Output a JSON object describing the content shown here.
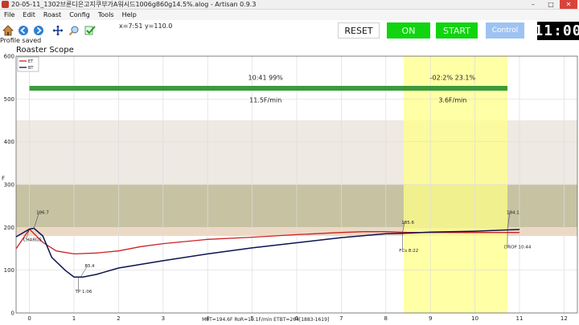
{
  "window": {
    "title": "20-05-11_1302브룬디은고지쿠부가A워시드1006g860g14.5%.alog - Artisan 0.9.3",
    "controls": [
      "–",
      "□",
      "✕"
    ]
  },
  "menu": {
    "items": [
      "File",
      "Edit",
      "Roast",
      "Config",
      "Tools",
      "Help"
    ]
  },
  "toolbar": {
    "icons": [
      "home-icon",
      "back-icon",
      "forward-icon",
      "pan-icon",
      "zoom-icon",
      "check-icon"
    ],
    "coordinates": "x=7:51  y=110.0",
    "status": "Profile saved"
  },
  "buttons": {
    "reset": "RESET",
    "on": "ON",
    "start": "START",
    "control": "Control"
  },
  "lcd": "11:00",
  "colors": {
    "et": "#cc2222",
    "bt": "#0a1450",
    "on_green": "#10d410",
    "control_blue": "#9ec3f2",
    "phase_bar": "#3c9a3c",
    "highlight": "#ffff88"
  },
  "chart_data": {
    "type": "line",
    "title": "Roaster Scope",
    "xlabel": "",
    "ylabel": "F",
    "xlim": [
      -0.3,
      12.3
    ],
    "ylim": [
      0,
      600
    ],
    "xticks": [
      "0",
      "1",
      "2",
      "3",
      "4",
      "5",
      "6",
      "7",
      "8",
      "9",
      "10",
      "11",
      "12"
    ],
    "yticks": [
      "0",
      "100",
      "200",
      "300",
      "400",
      "500",
      "600"
    ],
    "grid": true,
    "legend": {
      "placement": "top-left",
      "entries": [
        "ET",
        "BT"
      ]
    },
    "bands": [
      {
        "from": 180,
        "to": 300,
        "color": "#ecd9c5"
      },
      {
        "from": 200,
        "to": 300,
        "color": "#c7c2a2"
      },
      {
        "from": 300,
        "to": 450,
        "color": "#eee9e2"
      }
    ],
    "highlight_x": [
      8.4,
      10.73
    ],
    "phase_bar": {
      "y": 525,
      "from": 0,
      "to": 10.73
    },
    "phase_labels": [
      {
        "text": "10:41  99%",
        "x": 5.3,
        "y": 545
      },
      {
        "text": "11.5F/min",
        "x": 5.3,
        "y": 492
      },
      {
        "text": "-02:2%  23.1%",
        "x": 9.5,
        "y": 545
      },
      {
        "text": "3.6F/min",
        "x": 9.5,
        "y": 492
      }
    ],
    "series": [
      {
        "name": "ET",
        "color": "#cc2222",
        "x": [
          -0.3,
          0,
          0.3,
          0.6,
          1,
          1.5,
          2,
          2.5,
          3,
          4,
          5,
          6,
          7,
          7.5,
          8,
          8.5,
          9,
          10,
          11
        ],
        "y": [
          150,
          196,
          165,
          145,
          138,
          140,
          145,
          155,
          162,
          172,
          177,
          183,
          188,
          190,
          190,
          188,
          188,
          188,
          188
        ]
      },
      {
        "name": "BT",
        "color": "#0a1450",
        "x": [
          -0.3,
          0,
          0.1,
          0.3,
          0.5,
          0.8,
          1,
          1.2,
          1.5,
          2,
          3,
          4,
          5,
          6,
          7,
          8,
          8.37,
          9,
          10,
          10.73,
          11
        ],
        "y": [
          178,
          196,
          198,
          180,
          130,
          100,
          84,
          84,
          90,
          105,
          122,
          138,
          152,
          164,
          176,
          185,
          186,
          189,
          191,
          194,
          195
        ]
      }
    ],
    "annotations": [
      {
        "text": "196.7",
        "x": 0.1,
        "y": 198
      },
      {
        "text": "CHARGE",
        "x": 0,
        "y": 196
      },
      {
        "text": "83.4",
        "x": 1.15,
        "y": 84
      },
      {
        "text": "TP 1:06",
        "x": 1.1,
        "y": 84
      },
      {
        "text": "185.6",
        "x": 8.37,
        "y": 186
      },
      {
        "text": "FCs 8:22",
        "x": 8.37,
        "y": 186
      },
      {
        "text": "194.1",
        "x": 10.73,
        "y": 194
      },
      {
        "text": "DROP 10:44",
        "x": 10.73,
        "y": 194
      }
    ],
    "footer": "MET=194.6F   RoR=10.1F/min   ETBT=264[1883-1619]"
  }
}
